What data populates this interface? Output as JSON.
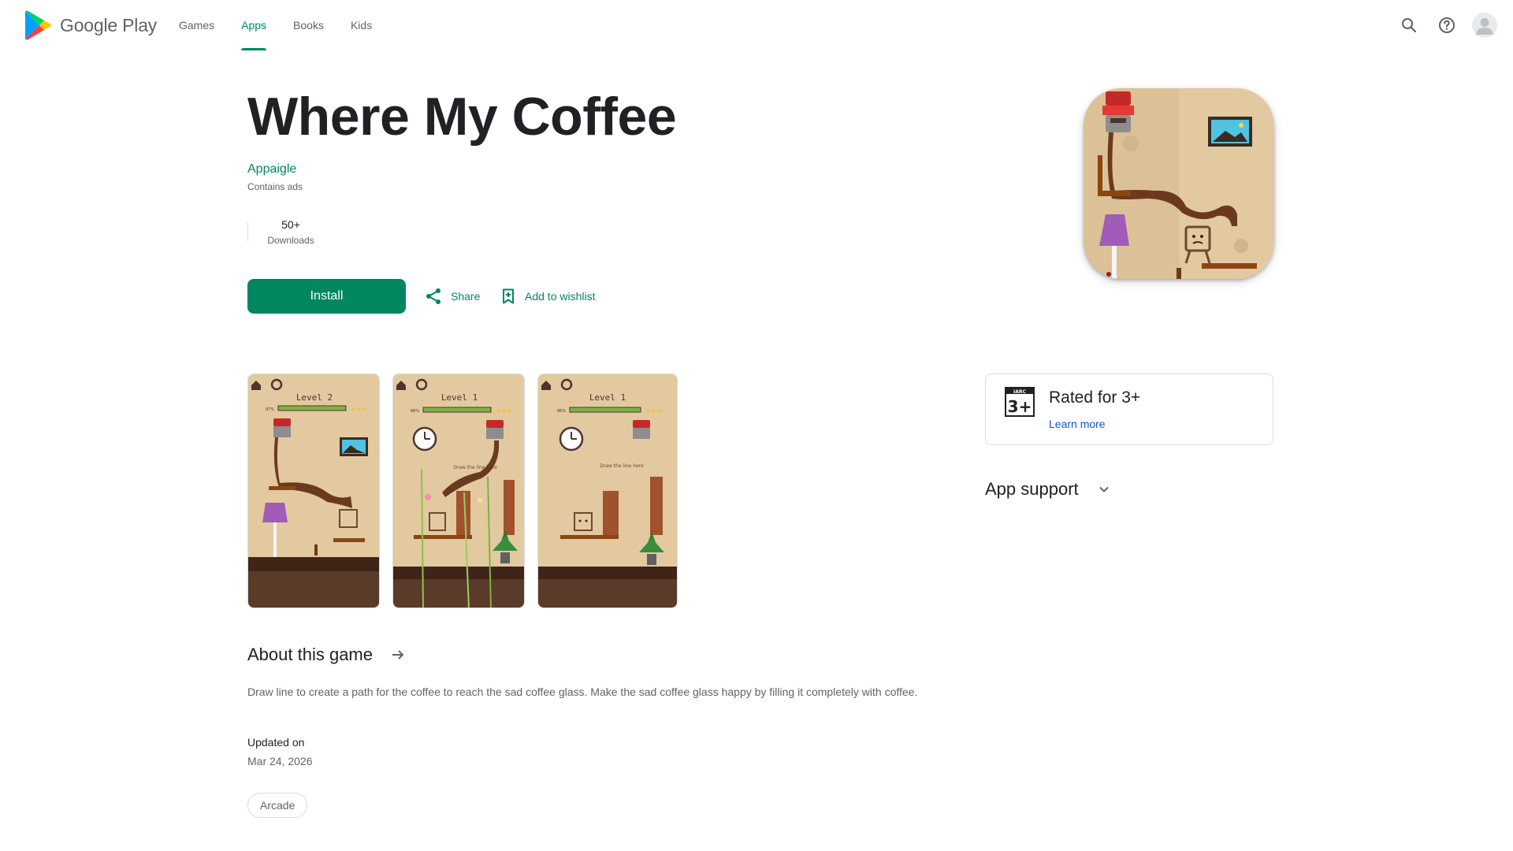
{
  "header": {
    "brand": "Google Play",
    "tabs": [
      {
        "label": "Games",
        "active": false
      },
      {
        "label": "Apps",
        "active": true
      },
      {
        "label": "Books",
        "active": false
      },
      {
        "label": "Kids",
        "active": false
      }
    ],
    "icons": [
      "search-icon",
      "help-icon",
      "account-avatar"
    ]
  },
  "app": {
    "title": "Where My Coffee",
    "developer": "Appaigle",
    "ads_note": "Contains ads",
    "downloads_value": "50+",
    "downloads_label": "Downloads",
    "install_label": "Install",
    "share_label": "Share",
    "wishlist_label": "Add to wishlist"
  },
  "screenshots": [
    {
      "level": "Level 2",
      "progress": "97%"
    },
    {
      "level": "Level 1",
      "progress": "86%",
      "hint": "Draw the line here"
    },
    {
      "level": "Level 1",
      "progress": "96%",
      "hint": "Draw the line here"
    }
  ],
  "rating": {
    "badge_top": "IARC",
    "badge_value": "3+",
    "label": "Rated for 3+",
    "learn_more": "Learn more"
  },
  "support": {
    "label": "App support"
  },
  "about": {
    "heading": "About this game",
    "description": "Draw line to create a path for the coffee to reach the sad coffee glass. Make the sad coffee glass happy by filling it completely with coffee.",
    "updated_label": "Updated on",
    "updated_value": "Mar 24, 2026",
    "category": "Arcade"
  },
  "colors": {
    "accent": "#01875f",
    "link": "#0b57d0",
    "wallpaper": "#e2c9a0",
    "floor": "#5a3a28",
    "coffee": "#6b3a1e"
  }
}
